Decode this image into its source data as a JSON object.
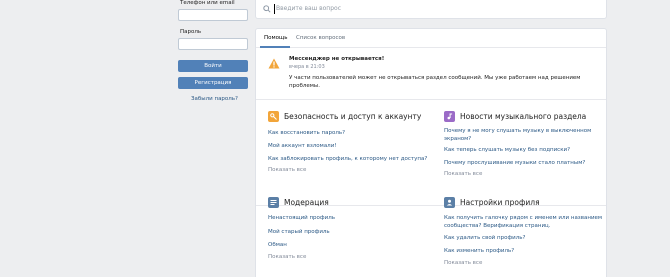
{
  "login": {
    "phone_label": "Телефон или email",
    "password_label": "Пароль",
    "login_button": "Войти",
    "register_button": "Регистрация",
    "forgot_link": "Забыли пароль?"
  },
  "search": {
    "placeholder": "Введите ваш вопрос"
  },
  "tabs": [
    {
      "label": "Помощь"
    },
    {
      "label": "Список вопросов"
    }
  ],
  "notice": {
    "title": "Мессенджер не открывается!",
    "date": "вчера в 21:03",
    "text": "У части пользователей может не открываться раздел сообщений. Мы уже работаем над решением проблемы."
  },
  "sections": [
    {
      "title": "Безопасность и доступ к аккаунту",
      "icon": "key-icon",
      "color": "#f2a53a",
      "links": [
        "Как восстановить пароль?",
        "Мой аккаунт взломали!",
        "Как заблокировать профиль, к которому нет доступа?"
      ],
      "more": "Показать все"
    },
    {
      "title": "Новости музыкального раздела",
      "icon": "music-note-icon",
      "color": "#9b6bc7",
      "links": [
        "Почему я не могу слушать музыку в выключенном экраном?",
        "Как теперь слушать музыку без подписки?",
        "Почему прослушивание музыки стало платным?"
      ],
      "more": "Показать все"
    },
    {
      "title": "Модерация",
      "icon": "moderation-icon",
      "color": "#5b7fa6",
      "links": [
        "Ненастоящий профиль",
        "Мой старый профиль",
        "Обман"
      ],
      "more": "Показать все"
    },
    {
      "title": "Настройки профиля",
      "icon": "profile-settings-icon",
      "color": "#5b7fa6",
      "links": [
        "Как получить галочку рядом с именем или названием сообщества? Верификация страниц.",
        "Как удалить свой профиль?",
        "Как изменить профиль?"
      ],
      "more": "Показать все"
    }
  ]
}
